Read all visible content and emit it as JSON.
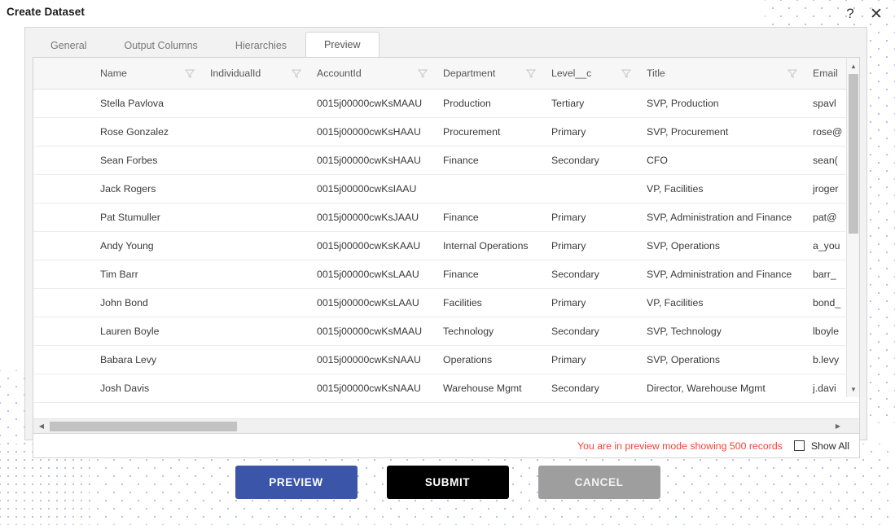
{
  "header": {
    "title": "Create Dataset",
    "help_icon": "help-icon",
    "close_icon": "close-icon",
    "help_glyph": "?",
    "close_glyph": "✕"
  },
  "tabs": [
    {
      "label": "General",
      "active": false
    },
    {
      "label": "Output Columns",
      "active": false
    },
    {
      "label": "Hierarchies",
      "active": false
    },
    {
      "label": "Preview",
      "active": true
    }
  ],
  "grid": {
    "columns": [
      {
        "label": "Name",
        "filterable": false
      },
      {
        "label": "IndividualId",
        "filterable": true
      },
      {
        "label": "AccountId",
        "filterable": true
      },
      {
        "label": "Department",
        "filterable": true
      },
      {
        "label": "Level__c",
        "filterable": true
      },
      {
        "label": "Title",
        "filterable": true
      },
      {
        "label": "Email",
        "filterable": true
      }
    ],
    "rows": [
      {
        "name": "Stella Pavlova",
        "individual_id": "",
        "account_id": "0015j00000cwKsMAAU",
        "department": "Production",
        "level": "Tertiary",
        "title": "SVP, Production",
        "email": "spavl"
      },
      {
        "name": "Rose Gonzalez",
        "individual_id": "",
        "account_id": "0015j00000cwKsHAAU",
        "department": "Procurement",
        "level": "Primary",
        "title": "SVP, Procurement",
        "email": "rose@"
      },
      {
        "name": "Sean Forbes",
        "individual_id": "",
        "account_id": "0015j00000cwKsHAAU",
        "department": "Finance",
        "level": "Secondary",
        "title": "CFO",
        "email": "sean("
      },
      {
        "name": "Jack Rogers",
        "individual_id": "",
        "account_id": "0015j00000cwKsIAAU",
        "department": "",
        "level": "",
        "title": "VP, Facilities",
        "email": "jroger"
      },
      {
        "name": "Pat Stumuller",
        "individual_id": "",
        "account_id": "0015j00000cwKsJAAU",
        "department": "Finance",
        "level": "Primary",
        "title": "SVP, Administration and Finance",
        "email": "pat@"
      },
      {
        "name": "Andy Young",
        "individual_id": "",
        "account_id": "0015j00000cwKsKAAU",
        "department": "Internal Operations",
        "level": "Primary",
        "title": "SVP, Operations",
        "email": "a_you"
      },
      {
        "name": "Tim Barr",
        "individual_id": "",
        "account_id": "0015j00000cwKsLAAU",
        "department": "Finance",
        "level": "Secondary",
        "title": "SVP, Administration and Finance",
        "email": "barr_"
      },
      {
        "name": "John Bond",
        "individual_id": "",
        "account_id": "0015j00000cwKsLAAU",
        "department": "Facilities",
        "level": "Primary",
        "title": "VP, Facilities",
        "email": "bond_"
      },
      {
        "name": "Lauren Boyle",
        "individual_id": "",
        "account_id": "0015j00000cwKsMAAU",
        "department": "Technology",
        "level": "Secondary",
        "title": "SVP, Technology",
        "email": "lboyle"
      },
      {
        "name": "Babara Levy",
        "individual_id": "",
        "account_id": "0015j00000cwKsNAAU",
        "department": "Operations",
        "level": "Primary",
        "title": "SVP, Operations",
        "email": "b.levy"
      },
      {
        "name": "Josh Davis",
        "individual_id": "",
        "account_id": "0015j00000cwKsNAAU",
        "department": "Warehouse Mgmt",
        "level": "Secondary",
        "title": "Director, Warehouse Mgmt",
        "email": "j.davi"
      }
    ]
  },
  "status": {
    "preview_message": "You are in preview mode showing 500 records",
    "record_count": 500,
    "show_all_label": "Show All",
    "show_all_checked": false,
    "message_color": "#f04438"
  },
  "footer": {
    "preview_label": "PREVIEW",
    "submit_label": "SUBMIT",
    "cancel_label": "CANCEL",
    "preview_color": "#3b55a8",
    "submit_color": "#000000",
    "cancel_color": "#9e9e9e"
  },
  "scrollbars": {
    "v_up_glyph": "▲",
    "v_down_glyph": "▼",
    "h_left_glyph": "◀",
    "h_right_glyph": "▶"
  }
}
